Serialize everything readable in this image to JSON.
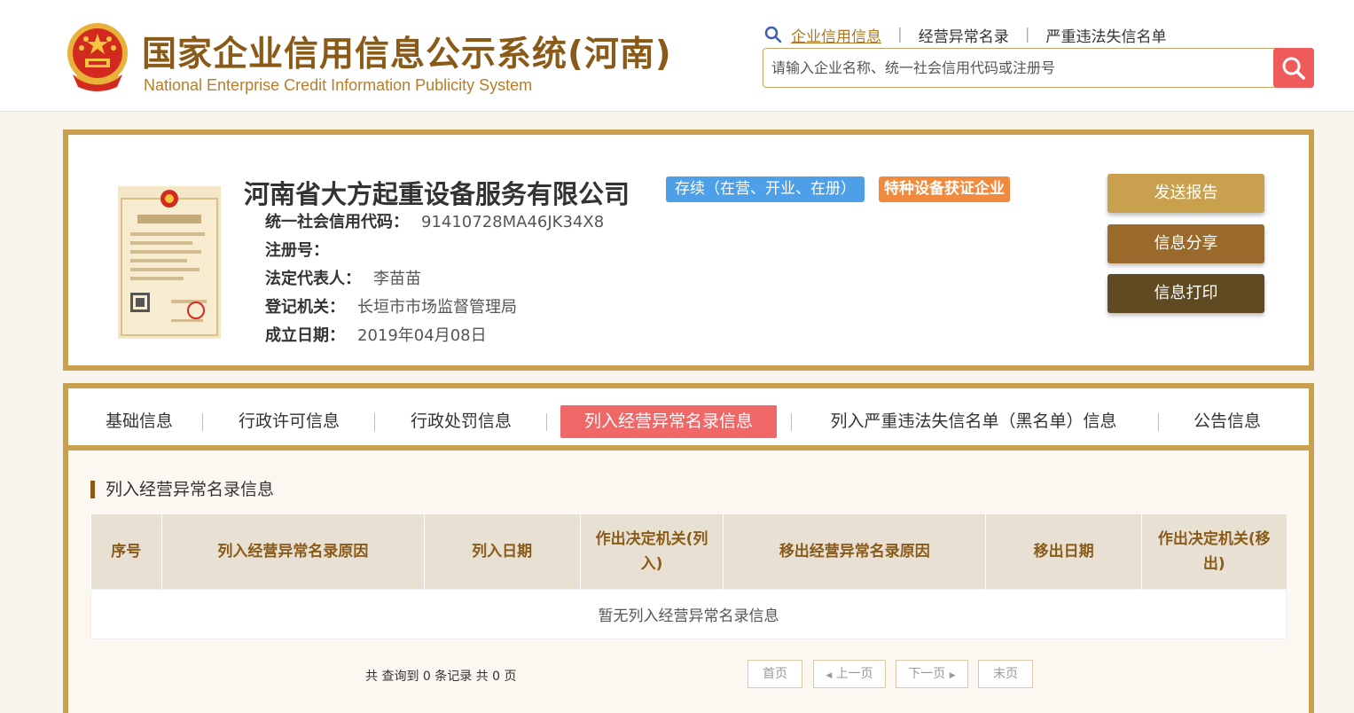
{
  "header": {
    "title": "国家企业信用信息公示系统(河南)",
    "subtitle": "National Enterprise Credit Information Publicity System",
    "nav": [
      {
        "label": "企业信用信息",
        "active": true
      },
      {
        "label": "经营异常名录",
        "active": false
      },
      {
        "label": "严重违法失信名单",
        "active": false
      }
    ],
    "search_placeholder": "请输入企业名称、统一社会信用代码或注册号"
  },
  "company": {
    "name": "河南省大方起重设备服务有限公司",
    "status": "存续（在营、开业、在册）",
    "special_tag": "特种设备获证企业",
    "fields": [
      {
        "label": "统一社会信用代码：",
        "value": "91410728MA46JK34X8"
      },
      {
        "label": "注册号：",
        "value": ""
      },
      {
        "label": "法定代表人：",
        "value": "李苗苗"
      },
      {
        "label": "登记机关：",
        "value": "长垣市市场监督管理局"
      },
      {
        "label": "成立日期：",
        "value": "2019年04月08日"
      }
    ],
    "actions": {
      "send_report": "发送报告",
      "share": "信息分享",
      "print": "信息打印"
    }
  },
  "tabs": [
    {
      "label": "基础信息",
      "active": false
    },
    {
      "label": "行政许可信息",
      "active": false
    },
    {
      "label": "行政处罚信息",
      "active": false
    },
    {
      "label": "列入经营异常名录信息",
      "active": true
    },
    {
      "label": "列入严重违法失信名单（黑名单）信息",
      "active": false
    },
    {
      "label": "公告信息",
      "active": false
    }
  ],
  "section": {
    "title": "列入经营异常名录信息",
    "columns": [
      "序号",
      "列入经营异常名录原因",
      "列入日期",
      "作出决定机关(列入)",
      "移出经营异常名录原因",
      "移出日期",
      "作出决定机关(移出)"
    ],
    "empty_text": "暂无列入经营异常名录信息"
  },
  "pager": {
    "summary": "共 查询到 0 条记录 共 0 页",
    "first": "首页",
    "prev": "上一页",
    "next": "下一页",
    "last": "末页"
  },
  "colors": {
    "brand_gold": "#c9a14e",
    "brand_brown": "#8a5a18",
    "active_tab": "#ef6767",
    "status_blue": "#4d9fe8",
    "special_orange": "#f28a3d",
    "btn_report": "#c9a14e",
    "btn_share": "#9a6a2c",
    "btn_print": "#5f4a22"
  }
}
